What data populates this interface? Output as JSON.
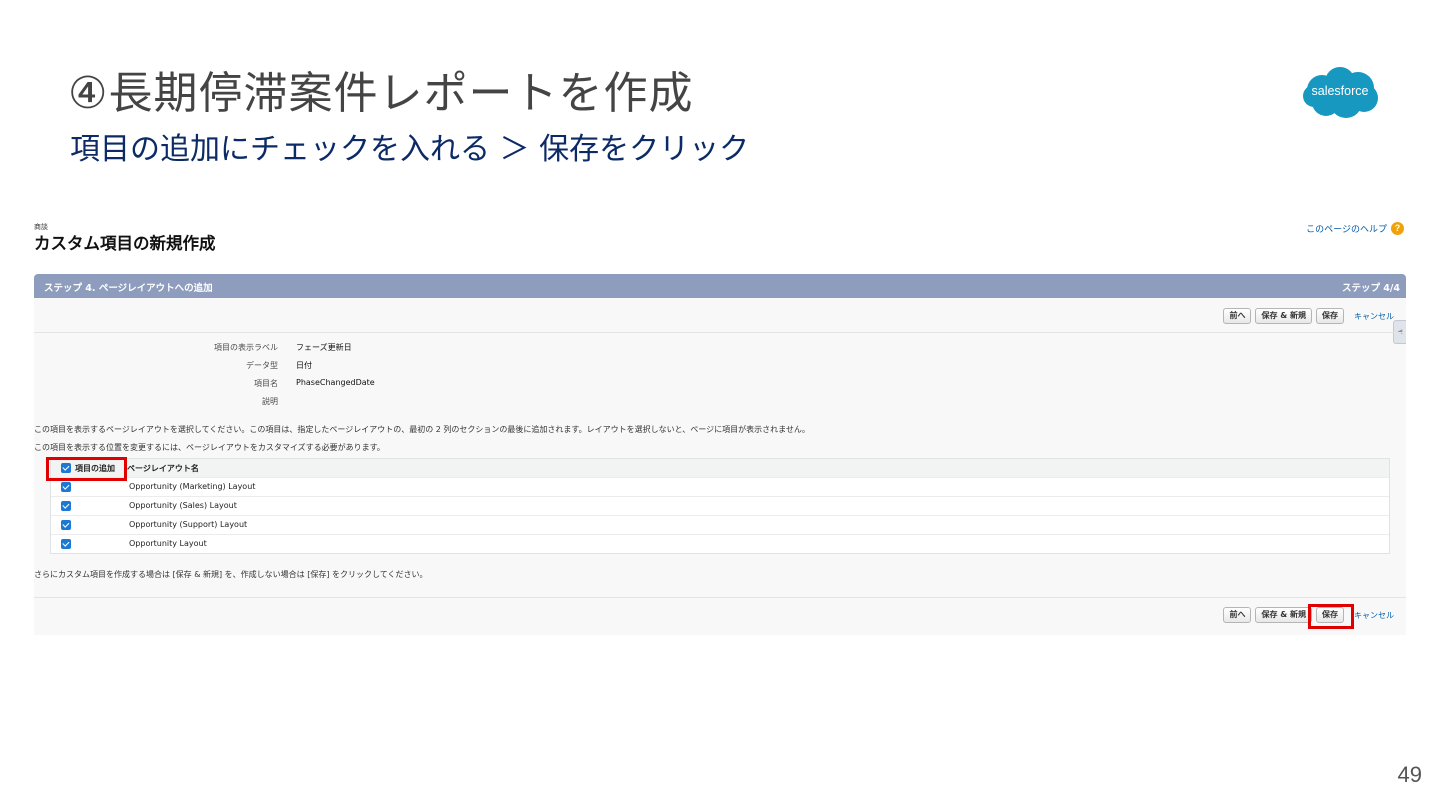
{
  "slide": {
    "title": "④長期停滞案件レポートを作成",
    "subtitle": "項目の追加にチェックを入れる ＞ 保存をクリック",
    "logo_text": "salesforce",
    "page_number": "49"
  },
  "sf": {
    "object_label": "商談",
    "page_title": "カスタム項目の新規作成",
    "help_link": "このページのヘルプ",
    "step_title": "ステップ 4. ページレイアウトへの追加",
    "step_counter": "ステップ 4/4",
    "buttons": {
      "prev": "前へ",
      "save_new": "保存 & 新規",
      "save": "保存",
      "cancel": "キャンセル"
    },
    "details": [
      {
        "label": "項目の表示ラベル",
        "value": "フェーズ更新日"
      },
      {
        "label": "データ型",
        "value": "日付"
      },
      {
        "label": "項目名",
        "value": "PhaseChangedDate"
      },
      {
        "label": "説明",
        "value": ""
      }
    ],
    "instruction_1": "この項目を表示するページレイアウトを選択してください。この項目は、指定したページレイアウトの、最初の 2 列のセクションの最後に追加されます。レイアウトを選択しないと、ページに項目が表示されません。",
    "instruction_2": "この項目を表示する位置を変更するには、ページレイアウトをカスタマイズする必要があります。",
    "table": {
      "header_add": "項目の追加",
      "header_name": "ページレイアウト名",
      "rows": [
        {
          "name": "Opportunity (Marketing) Layout",
          "checked": true
        },
        {
          "name": "Opportunity (Sales) Layout",
          "checked": true
        },
        {
          "name": "Opportunity (Support) Layout",
          "checked": true
        },
        {
          "name": "Opportunity Layout",
          "checked": true
        }
      ]
    },
    "footer_note": "さらにカスタム項目を作成する場合は [保存 & 新規] を、作成しない場合は [保存] をクリックしてください。"
  },
  "colors": {
    "header_bar": "#8e9dbe",
    "highlight": "#e00000",
    "subtitle": "#0b2a66",
    "checkbox": "#1b78d3"
  }
}
